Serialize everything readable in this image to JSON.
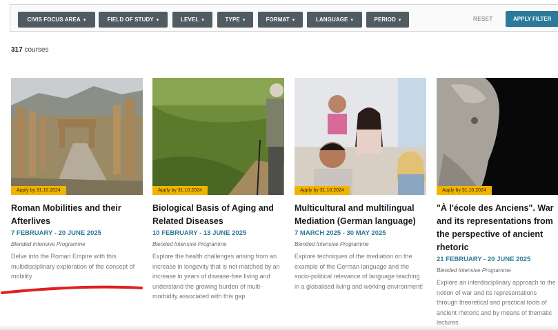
{
  "filters": [
    {
      "label": "CIVIS FOCUS AREA"
    },
    {
      "label": "FIELD OF STUDY"
    },
    {
      "label": "LEVEL"
    },
    {
      "label": "TYPE"
    },
    {
      "label": "FORMAT"
    },
    {
      "label": "LANGUAGE"
    },
    {
      "label": "PERIOD"
    }
  ],
  "actions": {
    "reset": "RESET",
    "apply": "APPLY FILTER"
  },
  "results": {
    "count": "317",
    "unit": "courses"
  },
  "courses": [
    {
      "badge": "Apply by 31.10.2024",
      "title": "Roman Mobilities and their Afterlives",
      "dates": "7 FEBRUARY - 20 JUNE 2025",
      "programme": "Blended Intensive Programme",
      "description": "Delve into the Roman Empire with this multidisciplinary exploration of the concept of mobility"
    },
    {
      "badge": "Apply by 31.10.2024",
      "title": "Biological Basis of Aging and Related Diseases",
      "dates": "10 FEBRUARY - 13 JUNE 2025",
      "programme": "Blended Intensive Programme",
      "description": "Explore the health challenges arising from an increase in longevity that is not matched by an increase in years of disease-free living and understand the growing burden of multi-morbidity associated with this gap"
    },
    {
      "badge": "Apply by 31.10.2024",
      "title": "Multicultural and multilingual Mediation (German language)",
      "dates": "7 MARCH 2025 - 30 MAY 2025",
      "programme": "Blended Intensive Programme",
      "description": "Explore techniques of the mediation on the example of the German language and the socio-political relevance of language teaching in a globalised living and working environment!"
    },
    {
      "badge": "Apply by 31.10.2024",
      "title": "\"À l'école des Anciens\". War and its representations from the perspective of ancient rhetoric",
      "dates": "21 FEBRUARY - 20 JUNE 2025",
      "programme": "Blended Intensive Programme",
      "description": "Explore an interdisciplinary approach to the notion of war and its representations through theoretical and practical tools of ancient rhetoric and by means of thematic lectures."
    }
  ],
  "colors": {
    "accent": "#2c7a9a",
    "badge": "#f0b400",
    "filter_button": "#515b62",
    "annotation": "#e02020"
  }
}
